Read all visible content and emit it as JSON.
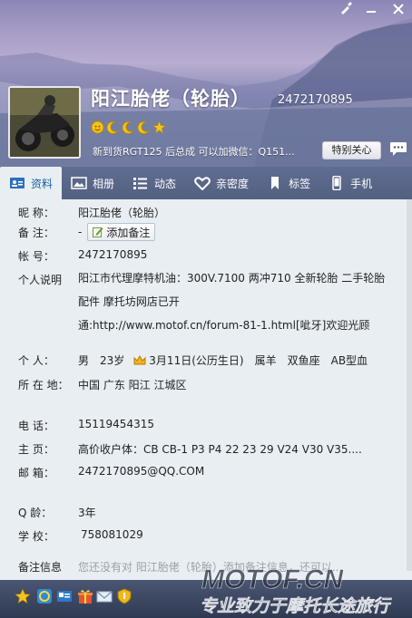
{
  "window": {
    "controls": {
      "skin": "skin-brush-icon",
      "minimize": "minimize-icon",
      "close": "close-icon"
    }
  },
  "profile": {
    "nickname": "阳江胎佬（轮胎）",
    "qq_number": "2472170895",
    "signature": "新到货RGT125 后总成  可以加微信：Q151...",
    "care_button": "特别关心"
  },
  "tabs": [
    {
      "label": "资料",
      "icon": "profile-card-icon"
    },
    {
      "label": "相册",
      "icon": "photo-album-icon"
    },
    {
      "label": "动态",
      "icon": "feed-list-icon"
    },
    {
      "label": "亲密度",
      "icon": "heart-icon"
    },
    {
      "label": "标签",
      "icon": "bookmark-tag-icon"
    },
    {
      "label": "手机",
      "icon": "mobile-phone-icon"
    }
  ],
  "info": {
    "nickname_label": "昵    称：",
    "nickname_value": "阳江胎佬（轮胎）",
    "remark_label": "备    注：",
    "remark_value": "-",
    "add_remark_button": "添加备注",
    "account_label": "帐    号：",
    "account_value": "2472170895",
    "bio_label": "个人说明",
    "bio_lines": [
      "阳江市代理摩特机油：300V.7100 两冲710 全新轮胎 二手轮胎",
      "配件 摩托坊网店已开",
      "通:http://www.motof.cn/forum-81-1.html[呲牙]欢迎光顾"
    ],
    "personal_label": "个    人：",
    "gender": "男",
    "age": "23岁",
    "birthday": "3月11日(公历生日)",
    "zodiac": "属羊",
    "constellation": "双鱼座",
    "blood_type": "AB型血",
    "location_label": "所 在 地：",
    "location_value": "中国 广东 阳江 江城区",
    "phone_label": "电    话：",
    "phone_value": "15119454315",
    "homepage_label": "主    页：",
    "homepage_value": "高价收户体：CB CB-1 P3 P4 22 23 29 V24 V30 V35....",
    "email_label": "邮    箱：",
    "email_value": "2472170895@QQ.COM",
    "qage_label": "Q     龄：",
    "qage_value": "3年",
    "school_label": "学    校：",
    "school_value": "758081029",
    "remark_info_label": "备注信息",
    "remark_info_value": "您还没有对 阳江胎佬（轮胎）添加备注信息，还可以..."
  },
  "bottombar": {
    "icons": [
      "star-icon",
      "qzone-icon",
      "mail-card-icon",
      "gift-icon",
      "envelope-icon",
      "shield-icon"
    ]
  },
  "watermark": {
    "logo": "MOTOF.CN",
    "slogan": "专业致力于摩托长途旅行"
  },
  "colors": {
    "tab_bar": "#5a6788",
    "panel_bg": "#e9eef3",
    "active_tab_text": "#1b5ea8",
    "watermark_red": "#d9241b"
  }
}
